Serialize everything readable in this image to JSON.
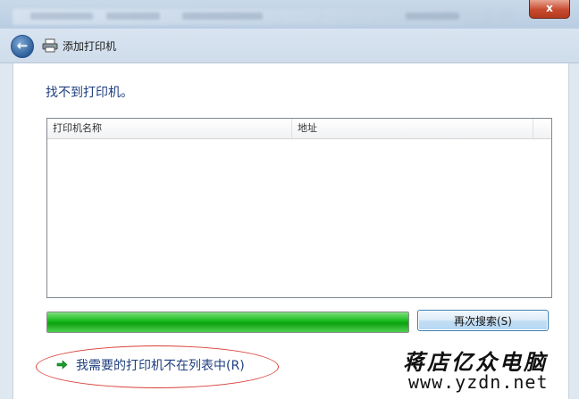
{
  "window": {
    "close_label": "x",
    "back_label": "←",
    "title": "添加打印机"
  },
  "main": {
    "heading": "找不到打印机。",
    "columns": [
      "打印机名称",
      "地址"
    ],
    "progress": 1.0,
    "search_again_label": "再次搜索(S)",
    "not_listed_link": "我需要的打印机不在列表中(R)"
  },
  "watermark": {
    "chinese": "蒋店亿众电脑",
    "url": "www.yzdn.net"
  },
  "colors": {
    "accent_text": "#1f3f7f",
    "progress_green": "#14b81a",
    "annotation_red": "#d8413a"
  },
  "icons": [
    "back-arrow-icon",
    "printer-icon",
    "green-arrow-icon"
  ]
}
